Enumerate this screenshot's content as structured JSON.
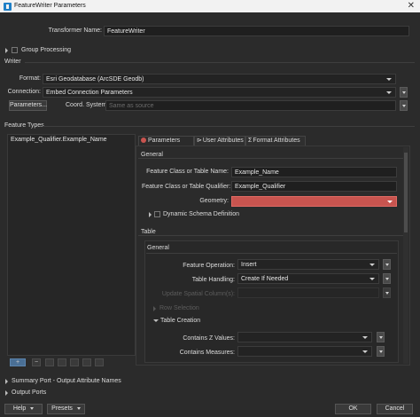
{
  "window": {
    "title": "FeatureWriter Parameters",
    "close_glyph": "✕"
  },
  "transformer_name": {
    "label": "Transformer Name:",
    "value": "FeatureWriter"
  },
  "group_processing": {
    "label": "Group Processing"
  },
  "writer": {
    "section_label": "Writer",
    "format_label": "Format:",
    "format_value": "Esri Geodatabase (ArcSDE Geodb)",
    "connection_label": "Connection:",
    "connection_value": "Embed Connection Parameters",
    "parameters_button": "Parameters...",
    "coord_label": "Coord. System:",
    "coord_placeholder": "Same as source"
  },
  "feature_types": {
    "section_label": "Feature Types",
    "items": [
      "Example_Qualifier.Example_Name"
    ],
    "add_glyph": "+",
    "remove_glyph": "−"
  },
  "tabs": [
    {
      "label": "Parameters",
      "icon": "parameters-icon",
      "active": true
    },
    {
      "label": "User Attributes",
      "icon": "user-attributes-icon",
      "active": false
    },
    {
      "label": "Format Attributes",
      "icon": "format-attributes-icon",
      "active": false
    }
  ],
  "general": {
    "section_label": "General",
    "table_name_label": "Feature Class or Table Name:",
    "table_name_value": "Example_Name",
    "qualifier_label": "Feature Class or Table Qualifier:",
    "qualifier_value": "Example_Qualifier",
    "geometry_label": "Geometry:",
    "geometry_value": "",
    "dynamic_schema_label": "Dynamic Schema Definition"
  },
  "table": {
    "section_label": "Table",
    "general_label": "General",
    "feature_operation_label": "Feature Operation:",
    "feature_operation_value": "Insert",
    "table_handling_label": "Table Handling:",
    "table_handling_value": "Create If Needed",
    "update_spatial_label": "Update Spatial Column(s):",
    "row_selection_label": "Row Selection",
    "table_creation_label": "Table Creation",
    "contains_z_label": "Contains Z Values:",
    "contains_measures_label": "Contains Measures:"
  },
  "summary_port": {
    "label": "Summary Port - Output Attribute Names"
  },
  "output_ports": {
    "label": "Output Ports"
  },
  "footer": {
    "help_label": "Help",
    "presets_label": "Presets",
    "ok_label": "OK",
    "cancel_label": "Cancel"
  },
  "colors": {
    "accent_red": "#c8544f",
    "background": "#2b2b2b",
    "title_bar": "#f2f2f2"
  }
}
